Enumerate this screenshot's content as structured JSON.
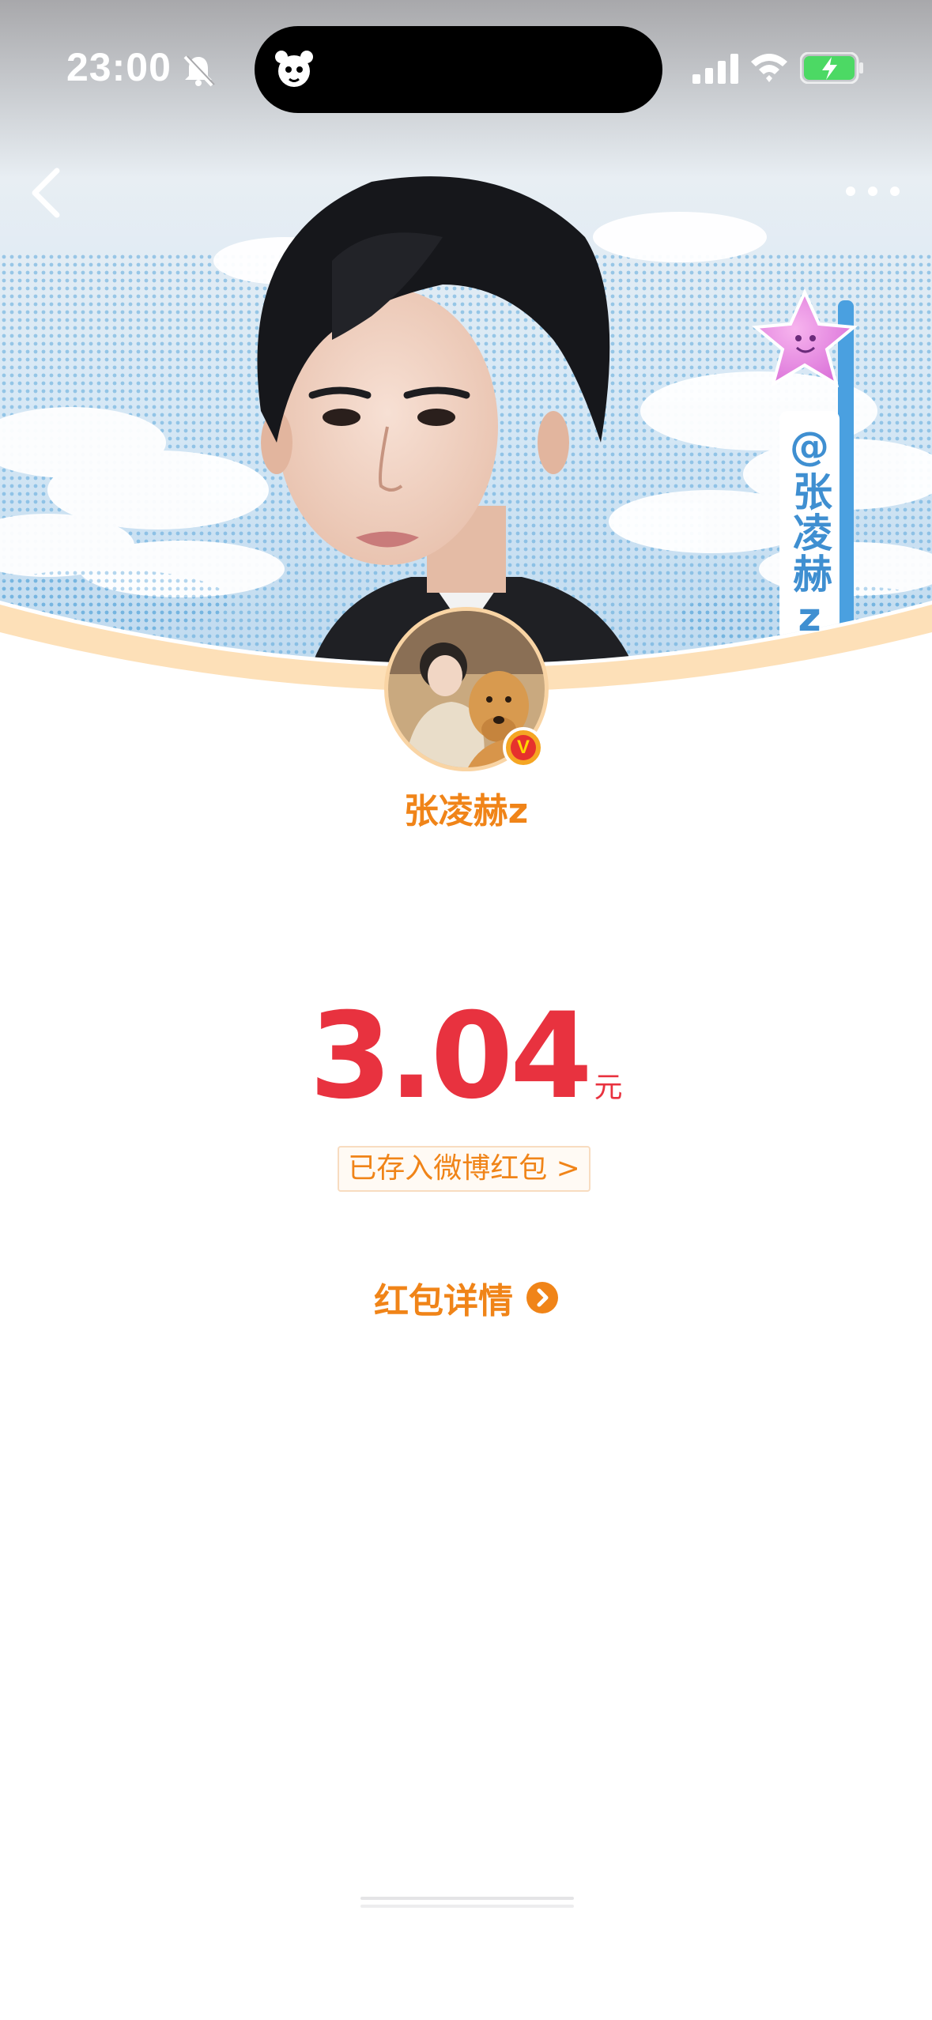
{
  "status_bar": {
    "time": "23:00",
    "icons": [
      "bell-slash-icon",
      "island-mascot-icon",
      "signal-icon",
      "wifi-icon",
      "battery-charging-icon"
    ]
  },
  "nav": {
    "back_icon": "chevron-left-icon",
    "more_icon": "more-dots-icon"
  },
  "banner": {
    "vertical_tag": "@张凌赫z",
    "sticker_icon": "star-sticker-icon"
  },
  "profile": {
    "name": "张凌赫z",
    "verified_badge": "V"
  },
  "red_packet": {
    "amount": "3.04",
    "unit": "元",
    "saved_label": "已存入微博红包 >",
    "detail_label": "红包详情"
  },
  "colors": {
    "accent_orange": "#f08418",
    "amount_red": "#e8323f",
    "sky_blue": "#5aa7db"
  }
}
